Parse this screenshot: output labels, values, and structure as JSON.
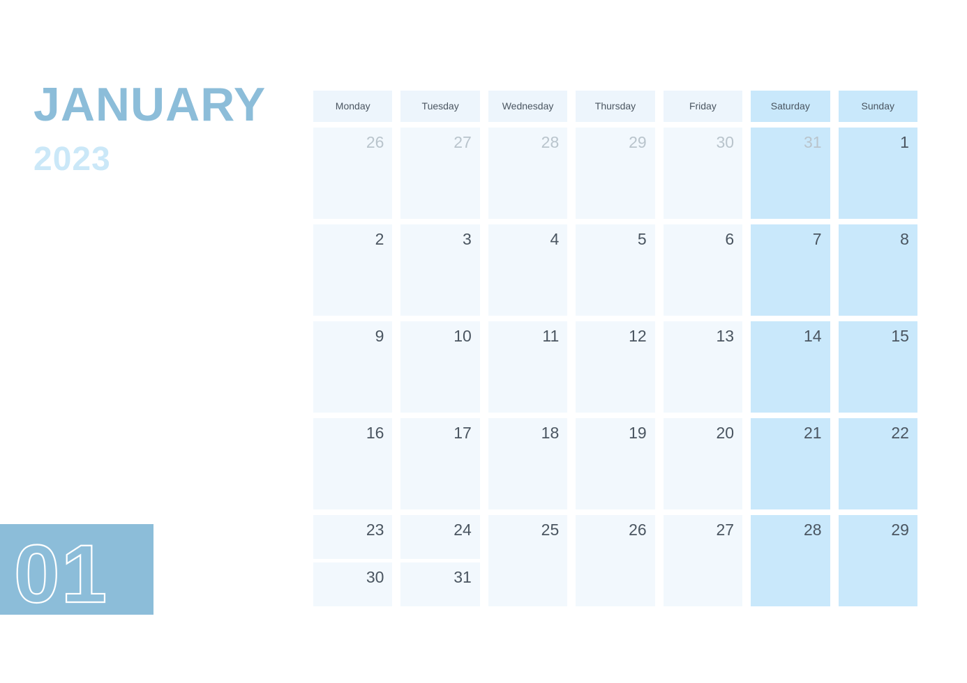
{
  "header": {
    "month": "JANUARY",
    "year": "2023",
    "month_number": "01"
  },
  "colors": {
    "month_title": "#8cbdd9",
    "year_title": "#cbe8f8",
    "badge_bg": "#8cbdd9",
    "weekday_header_bg": "#edf5fc",
    "weekend_header_bg": "#c9e8fb",
    "weekday_cell_bg": "#f2f8fd",
    "weekend_cell_bg": "#c9e8fb",
    "day_number": "#4a5560",
    "other_month_number": "#b9c4cc"
  },
  "weekdays": [
    {
      "label": "Monday",
      "weekend": false
    },
    {
      "label": "Tuesday",
      "weekend": false
    },
    {
      "label": "Wednesday",
      "weekend": false
    },
    {
      "label": "Thursday",
      "weekend": false
    },
    {
      "label": "Friday",
      "weekend": false
    },
    {
      "label": "Saturday",
      "weekend": true
    },
    {
      "label": "Sunday",
      "weekend": true
    }
  ],
  "weeks": [
    {
      "days": [
        {
          "cells": [
            {
              "number": "26",
              "other_month": true
            }
          ],
          "weekend": false
        },
        {
          "cells": [
            {
              "number": "27",
              "other_month": true
            }
          ],
          "weekend": false
        },
        {
          "cells": [
            {
              "number": "28",
              "other_month": true
            }
          ],
          "weekend": false
        },
        {
          "cells": [
            {
              "number": "29",
              "other_month": true
            }
          ],
          "weekend": false
        },
        {
          "cells": [
            {
              "number": "30",
              "other_month": true
            }
          ],
          "weekend": false
        },
        {
          "cells": [
            {
              "number": "31",
              "other_month": true
            }
          ],
          "weekend": true
        },
        {
          "cells": [
            {
              "number": "1",
              "other_month": false
            }
          ],
          "weekend": true
        }
      ]
    },
    {
      "days": [
        {
          "cells": [
            {
              "number": "2",
              "other_month": false
            }
          ],
          "weekend": false
        },
        {
          "cells": [
            {
              "number": "3",
              "other_month": false
            }
          ],
          "weekend": false
        },
        {
          "cells": [
            {
              "number": "4",
              "other_month": false
            }
          ],
          "weekend": false
        },
        {
          "cells": [
            {
              "number": "5",
              "other_month": false
            }
          ],
          "weekend": false
        },
        {
          "cells": [
            {
              "number": "6",
              "other_month": false
            }
          ],
          "weekend": false
        },
        {
          "cells": [
            {
              "number": "7",
              "other_month": false
            }
          ],
          "weekend": true
        },
        {
          "cells": [
            {
              "number": "8",
              "other_month": false
            }
          ],
          "weekend": true
        }
      ]
    },
    {
      "days": [
        {
          "cells": [
            {
              "number": "9",
              "other_month": false
            }
          ],
          "weekend": false
        },
        {
          "cells": [
            {
              "number": "10",
              "other_month": false
            }
          ],
          "weekend": false
        },
        {
          "cells": [
            {
              "number": "11",
              "other_month": false
            }
          ],
          "weekend": false
        },
        {
          "cells": [
            {
              "number": "12",
              "other_month": false
            }
          ],
          "weekend": false
        },
        {
          "cells": [
            {
              "number": "13",
              "other_month": false
            }
          ],
          "weekend": false
        },
        {
          "cells": [
            {
              "number": "14",
              "other_month": false
            }
          ],
          "weekend": true
        },
        {
          "cells": [
            {
              "number": "15",
              "other_month": false
            }
          ],
          "weekend": true
        }
      ]
    },
    {
      "days": [
        {
          "cells": [
            {
              "number": "16",
              "other_month": false
            }
          ],
          "weekend": false
        },
        {
          "cells": [
            {
              "number": "17",
              "other_month": false
            }
          ],
          "weekend": false
        },
        {
          "cells": [
            {
              "number": "18",
              "other_month": false
            }
          ],
          "weekend": false
        },
        {
          "cells": [
            {
              "number": "19",
              "other_month": false
            }
          ],
          "weekend": false
        },
        {
          "cells": [
            {
              "number": "20",
              "other_month": false
            }
          ],
          "weekend": false
        },
        {
          "cells": [
            {
              "number": "21",
              "other_month": false
            }
          ],
          "weekend": true
        },
        {
          "cells": [
            {
              "number": "22",
              "other_month": false
            }
          ],
          "weekend": true
        }
      ]
    },
    {
      "days": [
        {
          "cells": [
            {
              "number": "23",
              "other_month": false,
              "half": true
            },
            {
              "number": "30",
              "other_month": false,
              "half": true
            }
          ],
          "weekend": false
        },
        {
          "cells": [
            {
              "number": "24",
              "other_month": false,
              "half": true
            },
            {
              "number": "31",
              "other_month": false,
              "half": true
            }
          ],
          "weekend": false
        },
        {
          "cells": [
            {
              "number": "25",
              "other_month": false
            }
          ],
          "weekend": false
        },
        {
          "cells": [
            {
              "number": "26",
              "other_month": false
            }
          ],
          "weekend": false
        },
        {
          "cells": [
            {
              "number": "27",
              "other_month": false
            }
          ],
          "weekend": false
        },
        {
          "cells": [
            {
              "number": "28",
              "other_month": false
            }
          ],
          "weekend": true
        },
        {
          "cells": [
            {
              "number": "29",
              "other_month": false
            }
          ],
          "weekend": true
        }
      ]
    }
  ]
}
